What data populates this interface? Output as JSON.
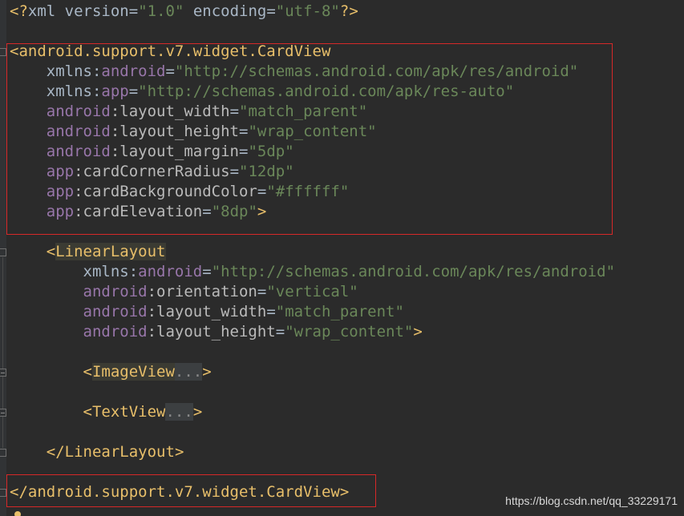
{
  "editor": {
    "lines": [
      {
        "id": "xml-decl",
        "parts": [
          {
            "c": "bracket",
            "t": "<?"
          },
          {
            "c": "plain",
            "t": "xml version"
          },
          {
            "c": "eq",
            "t": "="
          },
          {
            "c": "val",
            "t": "\"1.0\""
          },
          {
            "c": "plain",
            "t": " encoding"
          },
          {
            "c": "eq",
            "t": "="
          },
          {
            "c": "val",
            "t": "\"utf-8\""
          },
          {
            "c": "bracket",
            "t": "?>"
          }
        ]
      },
      {
        "id": "blank-1",
        "parts": []
      },
      {
        "id": "cardview-open",
        "parts": [
          {
            "c": "bracket",
            "t": "<"
          },
          {
            "c": "tag",
            "t": "android.support.v7.widget.CardView"
          }
        ]
      },
      {
        "id": "xmlns-android",
        "parts": [
          {
            "c": "plain",
            "t": "    xmlns:"
          },
          {
            "c": "ns",
            "t": "android"
          },
          {
            "c": "eq",
            "t": "="
          },
          {
            "c": "val",
            "t": "\"http://schemas.android.com/apk/res/android\""
          }
        ]
      },
      {
        "id": "xmlns-app",
        "parts": [
          {
            "c": "plain",
            "t": "    xmlns:"
          },
          {
            "c": "ns",
            "t": "app"
          },
          {
            "c": "eq",
            "t": "="
          },
          {
            "c": "val",
            "t": "\"http://schemas.android.com/apk/res-auto\""
          }
        ]
      },
      {
        "id": "card-layout-width",
        "parts": [
          {
            "c": "plain",
            "t": "    "
          },
          {
            "c": "ns",
            "t": "android"
          },
          {
            "c": "attr",
            "t": ":layout_width"
          },
          {
            "c": "eq",
            "t": "="
          },
          {
            "c": "val",
            "t": "\"match_parent\""
          }
        ]
      },
      {
        "id": "card-layout-height",
        "parts": [
          {
            "c": "plain",
            "t": "    "
          },
          {
            "c": "ns",
            "t": "android"
          },
          {
            "c": "attr",
            "t": ":layout_height"
          },
          {
            "c": "eq",
            "t": "="
          },
          {
            "c": "val",
            "t": "\"wrap_content\""
          }
        ]
      },
      {
        "id": "card-layout-margin",
        "parts": [
          {
            "c": "plain",
            "t": "    "
          },
          {
            "c": "ns",
            "t": "android"
          },
          {
            "c": "attr",
            "t": ":layout_margin"
          },
          {
            "c": "eq",
            "t": "="
          },
          {
            "c": "val",
            "t": "\"5dp\""
          }
        ]
      },
      {
        "id": "card-corner-radius",
        "parts": [
          {
            "c": "plain",
            "t": "    "
          },
          {
            "c": "ns",
            "t": "app"
          },
          {
            "c": "attr",
            "t": ":cardCornerRadius"
          },
          {
            "c": "eq",
            "t": "="
          },
          {
            "c": "val",
            "t": "\"12dp\""
          }
        ]
      },
      {
        "id": "card-background-color",
        "parts": [
          {
            "c": "plain",
            "t": "    "
          },
          {
            "c": "ns",
            "t": "app"
          },
          {
            "c": "attr",
            "t": ":cardBackgroundColor"
          },
          {
            "c": "eq",
            "t": "="
          },
          {
            "c": "val",
            "t": "\"#ffffff\""
          }
        ]
      },
      {
        "id": "card-elevation",
        "parts": [
          {
            "c": "plain",
            "t": "    "
          },
          {
            "c": "ns",
            "t": "app"
          },
          {
            "c": "attr",
            "t": ":cardElevation"
          },
          {
            "c": "eq",
            "t": "="
          },
          {
            "c": "val",
            "t": "\"8dp\""
          },
          {
            "c": "bracket",
            "t": ">"
          }
        ]
      },
      {
        "id": "blank-2",
        "parts": []
      },
      {
        "id": "linearlayout-open",
        "parts": [
          {
            "c": "plain",
            "t": "    "
          },
          {
            "c": "bracket",
            "t": "<"
          },
          {
            "c": "hl",
            "t": "LinearLayout"
          }
        ]
      },
      {
        "id": "ll-xmlns-android",
        "parts": [
          {
            "c": "plain",
            "t": "        xmlns:"
          },
          {
            "c": "ns",
            "t": "android"
          },
          {
            "c": "eq",
            "t": "="
          },
          {
            "c": "val",
            "t": "\"http://schemas.android.com/apk/res/android\""
          }
        ]
      },
      {
        "id": "ll-orientation",
        "parts": [
          {
            "c": "plain",
            "t": "        "
          },
          {
            "c": "ns",
            "t": "android"
          },
          {
            "c": "attr",
            "t": ":orientation"
          },
          {
            "c": "eq",
            "t": "="
          },
          {
            "c": "val",
            "t": "\"vertical\""
          }
        ]
      },
      {
        "id": "ll-layout-width",
        "parts": [
          {
            "c": "plain",
            "t": "        "
          },
          {
            "c": "ns",
            "t": "android"
          },
          {
            "c": "attr",
            "t": ":layout_width"
          },
          {
            "c": "eq",
            "t": "="
          },
          {
            "c": "val",
            "t": "\"match_parent\""
          }
        ]
      },
      {
        "id": "ll-layout-height",
        "parts": [
          {
            "c": "plain",
            "t": "        "
          },
          {
            "c": "ns",
            "t": "android"
          },
          {
            "c": "attr",
            "t": ":layout_height"
          },
          {
            "c": "eq",
            "t": "="
          },
          {
            "c": "val",
            "t": "\"wrap_content\""
          },
          {
            "c": "bracket",
            "t": ">"
          }
        ]
      },
      {
        "id": "blank-3",
        "parts": []
      },
      {
        "id": "imageview-folded",
        "parts": [
          {
            "c": "plain",
            "t": "        "
          },
          {
            "c": "bracket",
            "t": "<"
          },
          {
            "c": "hl",
            "t": "ImageView"
          },
          {
            "c": "fold-dots",
            "t": "..."
          },
          {
            "c": "bracket",
            "t": ">"
          }
        ]
      },
      {
        "id": "blank-4",
        "parts": []
      },
      {
        "id": "textview-folded",
        "parts": [
          {
            "c": "plain",
            "t": "        "
          },
          {
            "c": "bracket",
            "t": "<"
          },
          {
            "c": "tag",
            "t": "TextView"
          },
          {
            "c": "fold-dots",
            "t": "..."
          },
          {
            "c": "bracket",
            "t": ">"
          }
        ]
      },
      {
        "id": "blank-5",
        "parts": []
      },
      {
        "id": "linearlayout-close",
        "parts": [
          {
            "c": "plain",
            "t": "    "
          },
          {
            "c": "bracket",
            "t": "</"
          },
          {
            "c": "tag",
            "t": "LinearLayout"
          },
          {
            "c": "bracket",
            "t": ">"
          }
        ]
      },
      {
        "id": "blank-6",
        "parts": []
      },
      {
        "id": "cardview-close",
        "parts": [
          {
            "c": "bracket",
            "t": "</"
          },
          {
            "c": "tag",
            "t": "android.support.v7.widget.CardView"
          },
          {
            "c": "bracket",
            "t": ">"
          }
        ]
      }
    ]
  },
  "watermark": "https://blog.csdn.net/qq_33229171",
  "colors": {
    "background": "#2b2b2b",
    "tag": "#e8bf6a",
    "namespace": "#9876aa",
    "value": "#6a8759",
    "text": "#a9b7c6",
    "highlight_box": "#d62828"
  }
}
